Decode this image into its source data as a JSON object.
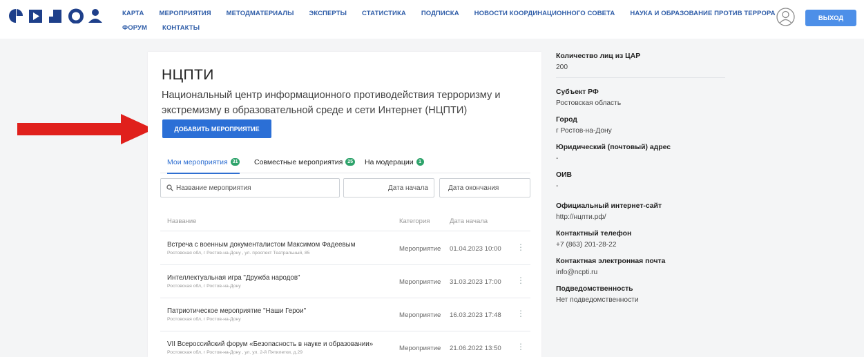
{
  "nav": {
    "row1": [
      "КАРТА",
      "МЕРОПРИЯТИЯ",
      "МЕТОДМАТЕРИАЛЫ",
      "ЭКСПЕРТЫ",
      "СТАТИСТИКА",
      "ПОДПИСКА",
      "НОВОСТИ КООРДИНАЦИОННОГО СОВЕТА",
      "НАУКА И ОБРАЗОВАНИЕ ПРОТИВ ТЕРРОРА"
    ],
    "row2": [
      "ФОРУМ",
      "КОНТАКТЫ"
    ]
  },
  "header": {
    "logout_label": "ВЫХОД"
  },
  "org": {
    "short_name": "НЦПТИ",
    "full_name": "Национальный центр информационного противодействия терроризму и экстремизму в образовательной среде и сети Интернет (НЦПТИ)"
  },
  "actions": {
    "add_event_label": "ДОБАВИТЬ МЕРОПРИЯТИЕ"
  },
  "tabs": [
    {
      "label": "Мои мероприятия",
      "count": "31"
    },
    {
      "label": "Совместные мероприятия",
      "count": "25"
    },
    {
      "label": "На модерации",
      "count": "1"
    }
  ],
  "filters": {
    "search_placeholder": "Название мероприятия",
    "date_start_placeholder": "Дата начала",
    "date_end_placeholder": "Дата окончания"
  },
  "table": {
    "columns": [
      "Название",
      "Категория",
      "Дата начала"
    ],
    "rows": [
      {
        "title": "Встреча с военным документалистом Максимом Фадеевым",
        "address": "Ростовская обл, г Ростов-на-Дону , ул. проспект Театральный, 85",
        "category": "Мероприятие",
        "date": "01.04.2023 10:00"
      },
      {
        "title": "Интеллектуальная игра \"Дружба народов\"",
        "address": "Ростовская обл, г Ростов-на-Дону",
        "category": "Мероприятие",
        "date": "31.03.2023 17:00"
      },
      {
        "title": "Патриотическое мероприятие \"Наши Герои\"",
        "address": "Ростовская обл, г Ростов-на-Дону",
        "category": "Мероприятие",
        "date": "16.03.2023 17:48"
      },
      {
        "title": "VII Всероссийский форум «Безопасность в науке и образовании»",
        "address": "Ростовская обл, г Ростов-на-Дону , ул. ул. 2-й Пятилетки, д.29",
        "category": "Мероприятие",
        "date": "21.06.2022 13:50"
      }
    ]
  },
  "info": [
    {
      "label": "Количество лиц из ЦАР",
      "value": "200"
    },
    {
      "label": "Субъект РФ",
      "value": "Ростовская область"
    },
    {
      "label": "Город",
      "value": "г Ростов-на-Дону"
    },
    {
      "label": "Юридический (почтовый) адрес",
      "value": "-"
    },
    {
      "label": "ОИВ",
      "value": "-"
    },
    {
      "label": "Официальный интернет-сайт",
      "value": "http://нцпти.рф/"
    },
    {
      "label": "Контактный телефон",
      "value": "+7 (863) 201-28-22"
    },
    {
      "label": "Контактная электронная почта",
      "value": "info@ncpti.ru"
    },
    {
      "label": "Подведомственность",
      "value": "Нет подведомственности"
    }
  ],
  "colors": {
    "accent": "#2b6fd6",
    "nav_text": "#2f5da8",
    "badge": "#2ea36b",
    "logo": "#1e3f8a",
    "annotation_arrow": "#e0201c"
  },
  "icons": [
    "logo-icon",
    "profile-icon",
    "search-icon",
    "more-vertical-icon",
    "red-arrow-icon"
  ]
}
